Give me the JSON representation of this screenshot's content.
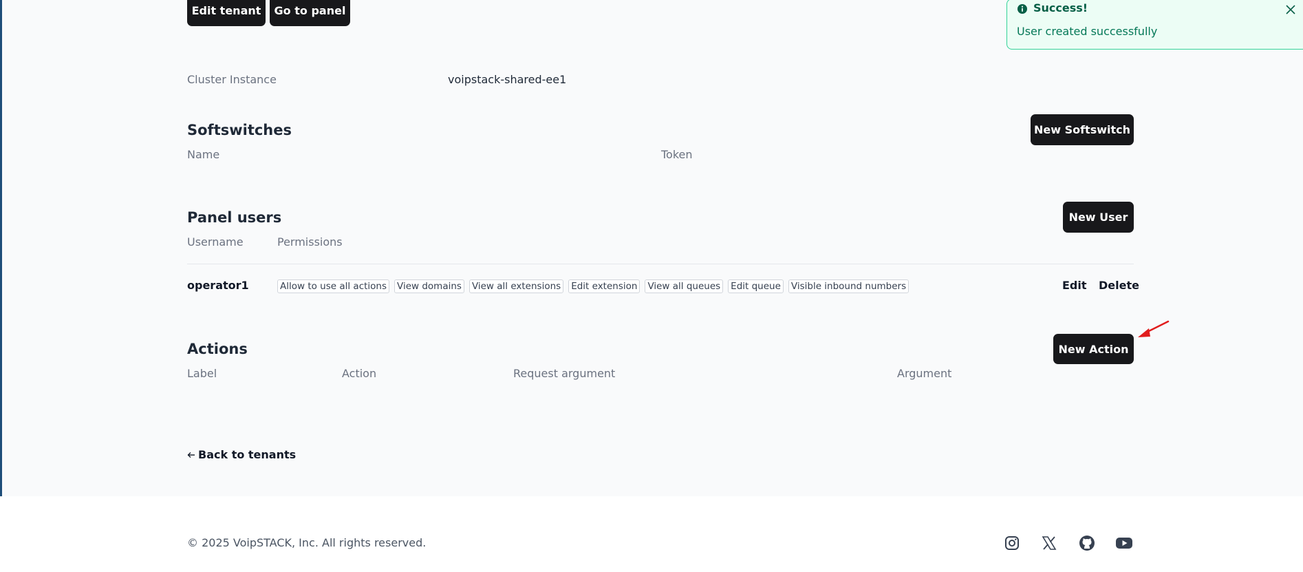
{
  "header_buttons": {
    "edit_tenant": "Edit tenant",
    "go_to_panel": "Go to panel"
  },
  "cluster": {
    "label": "Cluster Instance",
    "value": "voipstack-shared-ee1"
  },
  "softswitches": {
    "title": "Softswitches",
    "new_button": "New Softswitch",
    "columns": [
      "Name",
      "Token"
    ]
  },
  "panel_users": {
    "title": "Panel users",
    "new_button": "New User",
    "columns": [
      "Username",
      "Permissions"
    ],
    "rows": [
      {
        "username": "operator1",
        "permissions": [
          "Allow to use all actions",
          "View domains",
          "View all extensions",
          "Edit extension",
          "View all queues",
          "Edit queue",
          "Visible inbound numbers"
        ],
        "edit": "Edit",
        "delete": "Delete"
      }
    ]
  },
  "actions": {
    "title": "Actions",
    "new_button": "New Action",
    "columns": [
      "Label",
      "Action",
      "Request argument",
      "Argument"
    ]
  },
  "back_link": "Back to tenants",
  "footer": {
    "copyright": "© 2025 VoipSTACK, Inc. All rights reserved.",
    "social": [
      "instagram-icon",
      "x-icon",
      "github-icon",
      "youtube-icon"
    ]
  },
  "toast": {
    "title": "Success!",
    "message": "User created successfully"
  },
  "colors": {
    "primary_button": "#18181b",
    "toast_bg": "#ecfdf5",
    "toast_border": "#34d399",
    "annotation_arrow": "#e11d1d"
  }
}
